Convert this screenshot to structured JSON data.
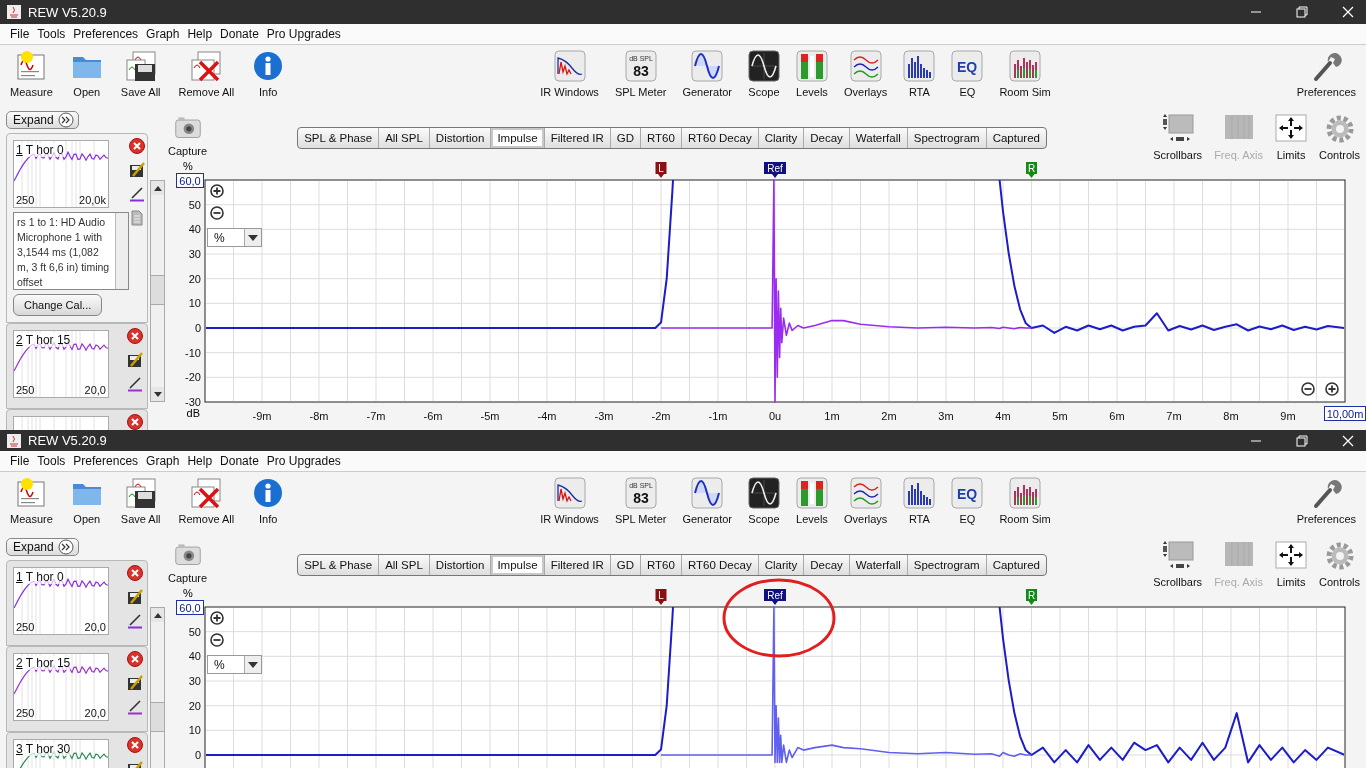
{
  "windows": [
    {
      "title": "REW V5.20.9",
      "menu": [
        "File",
        "Tools",
        "Preferences",
        "Graph",
        "Help",
        "Donate",
        "Pro Upgrades"
      ],
      "toolbar_left": [
        {
          "kind": "measure",
          "label": "Measure"
        },
        {
          "kind": "open",
          "label": "Open"
        },
        {
          "kind": "save",
          "label": "Save All"
        },
        {
          "kind": "remove",
          "label": "Remove All"
        },
        {
          "kind": "info",
          "label": "Info"
        }
      ],
      "toolbar_tools": [
        {
          "kind": "ir",
          "label": "IR Windows"
        },
        {
          "kind": "spl",
          "label": "SPL Meter",
          "icon_unit": "dB SPL",
          "icon_text": "83"
        },
        {
          "kind": "generator",
          "label": "Generator"
        },
        {
          "kind": "scope",
          "label": "Scope"
        },
        {
          "kind": "levels",
          "label": "Levels"
        },
        {
          "kind": "overlays",
          "label": "Overlays"
        },
        {
          "kind": "rta",
          "label": "RTA"
        },
        {
          "kind": "eq",
          "label": "EQ",
          "icon_text": "EQ"
        },
        {
          "kind": "roomsim",
          "label": "Room Sim"
        }
      ],
      "toolbar_right": [
        {
          "kind": "preferences",
          "label": "Preferences"
        }
      ],
      "expand_button": "Expand",
      "measurements": [
        {
          "number": "1",
          "name": "T hor 0",
          "color": "#8a2be2",
          "expanded": true,
          "axis_min": "250",
          "axis_max": "20,0k",
          "notes": "rs 1 to 1: HD Audio Microphone 1 with 3,1544 ms (1,082 m, 3 ft 6,6 in) timing offset",
          "button": "Change Cal..."
        },
        {
          "number": "2",
          "name": "T hor 15",
          "color": "#9b30d0",
          "expanded": false,
          "axis_min": "250",
          "axis_max": "20,0"
        },
        {
          "expanded": false
        }
      ],
      "capture": "Capture",
      "tabs": [
        {
          "label": "SPL & Phase",
          "selected": false
        },
        {
          "label": "All SPL",
          "selected": false
        },
        {
          "label": "Distortion",
          "selected": false
        },
        {
          "label": "Impulse",
          "selected": true
        },
        {
          "label": "Filtered IR",
          "selected": false
        },
        {
          "label": "GD",
          "selected": false
        },
        {
          "label": "RT60",
          "selected": false
        },
        {
          "label": "RT60 Decay",
          "selected": false
        },
        {
          "label": "Clarity",
          "selected": false
        },
        {
          "label": "Decay",
          "selected": false
        },
        {
          "label": "Waterfall",
          "selected": false
        },
        {
          "label": "Spectrogram",
          "selected": false
        },
        {
          "label": "Captured",
          "selected": false
        }
      ],
      "view_buttons": [
        {
          "kind": "scrollbars",
          "label": "Scrollbars",
          "disabled": false
        },
        {
          "kind": "freqaxis",
          "label": "Freq. Axis",
          "disabled": true
        },
        {
          "kind": "limits",
          "label": "Limits",
          "disabled": false
        },
        {
          "kind": "controls",
          "label": "Controls",
          "disabled": false
        }
      ],
      "chart": {
        "y_unit": "%",
        "y_bottom_unit": "dB",
        "unit_selector": "%",
        "markers": [
          {
            "kind": "left",
            "label": "L"
          },
          {
            "kind": "ref",
            "label": "Ref"
          },
          {
            "kind": "right",
            "label": "R"
          }
        ],
        "highlighted": false,
        "chart_data": {
          "type": "line",
          "grid": true,
          "xlim": [
            -10,
            10
          ],
          "ylim": [
            -30,
            60
          ],
          "x": [
            -10,
            -8,
            -6,
            -4,
            -2.1,
            -2,
            -1.9,
            -1.8,
            -1.79,
            -1,
            -0.05,
            -0.02,
            0,
            0.02,
            0.04,
            0.06,
            0.08,
            0.1,
            0.12,
            0.15,
            0.2,
            0.25,
            0.3,
            0.4,
            0.5,
            0.7,
            1,
            1.2,
            1.5,
            2,
            2.5,
            3,
            3.5,
            3.8,
            3.94,
            4,
            4.1,
            4.2,
            4.3,
            4.4,
            4.5,
            4.7,
            4.9,
            5.1,
            5.3,
            5.5,
            5.7,
            5.9,
            6.1,
            6.3,
            6.5,
            6.7,
            6.9,
            7.1,
            7.3,
            7.5,
            7.7,
            7.9,
            8.1,
            8.3,
            8.5,
            8.7,
            8.9,
            9.1,
            9.3,
            9.5,
            9.7,
            10
          ],
          "series": [
            {
              "color": "#1c1cc8",
              "values": [
                0,
                0,
                0,
                0,
                0,
                2.2,
                20,
                55.6,
                60,
                null,
                null,
                null,
                null,
                null,
                null,
                null,
                null,
                null,
                null,
                null,
                null,
                null,
                null,
                null,
                null,
                null,
                null,
                null,
                null,
                null,
                null,
                null,
                null,
                null,
                60,
                47.3,
                30.3,
                17,
                7.6,
                1.9,
                0,
                1,
                -2,
                0.5,
                -1,
                1,
                -0.5,
                1,
                -1,
                0.5,
                1,
                6,
                -1,
                0.8,
                -0.6,
                1,
                -0.8,
                0.5,
                1.5,
                -1,
                0.6,
                -0.5,
                1,
                -0.8,
                0.5,
                -0.6,
                0.8,
                0
              ]
            },
            {
              "color": "#9a2cf0",
              "values": [
                null,
                null,
                null,
                null,
                null,
                0,
                0,
                0,
                0,
                0,
                0,
                60,
                -30,
                20,
                -20,
                15,
                -12,
                8,
                -6,
                4,
                -3,
                2,
                -1,
                1,
                0,
                1,
                3,
                3,
                1.5,
                0.5,
                0,
                0.3,
                0,
                0.2,
                -0.2,
                0.3,
                0,
                -0.3,
                0.2,
                0,
                0,
                null,
                null,
                null,
                null,
                null,
                null,
                null,
                null,
                null,
                null,
                null,
                null,
                null,
                null,
                null,
                null,
                null,
                null,
                null,
                null,
                null,
                null,
                null,
                null,
                null,
                null,
                null
              ]
            }
          ],
          "xticks": [
            {
              "value": -9,
              "label": "-9m"
            },
            {
              "value": -8,
              "label": "-8m"
            },
            {
              "value": -7,
              "label": "-7m"
            },
            {
              "value": -6,
              "label": "-6m"
            },
            {
              "value": -5,
              "label": "-5m"
            },
            {
              "value": -4,
              "label": "-4m"
            },
            {
              "value": -3,
              "label": "-3m"
            },
            {
              "value": -2,
              "label": "-2m"
            },
            {
              "value": -1,
              "label": "-1m"
            },
            {
              "value": 0,
              "label": "0u"
            },
            {
              "value": 1,
              "label": "1m"
            },
            {
              "value": 2,
              "label": "2m"
            },
            {
              "value": 3,
              "label": "3m"
            },
            {
              "value": 4,
              "label": "4m"
            },
            {
              "value": 5,
              "label": "5m"
            },
            {
              "value": 6,
              "label": "6m"
            },
            {
              "value": 7,
              "label": "7m"
            },
            {
              "value": 8,
              "label": "8m"
            },
            {
              "value": 9,
              "label": "9m"
            },
            {
              "value": 10,
              "label": "10,00m"
            }
          ],
          "yticks": [
            {
              "value": 60,
              "label": "60,0"
            },
            50,
            40,
            30,
            20,
            10,
            0,
            -10,
            -20,
            -30
          ]
        }
      }
    },
    {
      "title": "REW V5.20.9",
      "menu": [
        "File",
        "Tools",
        "Preferences",
        "Graph",
        "Help",
        "Donate",
        "Pro Upgrades"
      ],
      "toolbar_left": [
        {
          "kind": "measure",
          "label": "Measure"
        },
        {
          "kind": "open",
          "label": "Open"
        },
        {
          "kind": "save",
          "label": "Save All"
        },
        {
          "kind": "remove",
          "label": "Remove All"
        },
        {
          "kind": "info",
          "label": "Info"
        }
      ],
      "toolbar_tools": [
        {
          "kind": "ir",
          "label": "IR Windows"
        },
        {
          "kind": "spl",
          "label": "SPL Meter",
          "icon_unit": "dB SPL",
          "icon_text": "83"
        },
        {
          "kind": "generator",
          "label": "Generator"
        },
        {
          "kind": "scope",
          "label": "Scope"
        },
        {
          "kind": "levels",
          "label": "Levels"
        },
        {
          "kind": "overlays",
          "label": "Overlays"
        },
        {
          "kind": "rta",
          "label": "RTA"
        },
        {
          "kind": "eq",
          "label": "EQ",
          "icon_text": "EQ"
        },
        {
          "kind": "roomsim",
          "label": "Room Sim"
        }
      ],
      "toolbar_right": [
        {
          "kind": "preferences",
          "label": "Preferences"
        }
      ],
      "expand_button": "Expand",
      "measurements": [
        {
          "number": "1",
          "name": "T hor 0",
          "color": "#8a2be2",
          "expanded": false,
          "axis_min": "250",
          "axis_max": "20,0"
        },
        {
          "number": "2",
          "name": "T hor 15",
          "color": "#9b30d0",
          "expanded": false,
          "axis_min": "250",
          "axis_max": "20,0"
        },
        {
          "number": "3",
          "name": "T hor 30",
          "color": "#2e8b57",
          "expanded": false
        }
      ],
      "capture": "Capture",
      "tabs": [
        {
          "label": "SPL & Phase",
          "selected": false
        },
        {
          "label": "All SPL",
          "selected": false
        },
        {
          "label": "Distortion",
          "selected": false
        },
        {
          "label": "Impulse",
          "selected": true
        },
        {
          "label": "Filtered IR",
          "selected": false
        },
        {
          "label": "GD",
          "selected": false
        },
        {
          "label": "RT60",
          "selected": false
        },
        {
          "label": "RT60 Decay",
          "selected": false
        },
        {
          "label": "Clarity",
          "selected": false
        },
        {
          "label": "Decay",
          "selected": false
        },
        {
          "label": "Waterfall",
          "selected": false
        },
        {
          "label": "Spectrogram",
          "selected": false
        },
        {
          "label": "Captured",
          "selected": false
        }
      ],
      "view_buttons": [
        {
          "kind": "scrollbars",
          "label": "Scrollbars",
          "disabled": false
        },
        {
          "kind": "freqaxis",
          "label": "Freq. Axis",
          "disabled": true
        },
        {
          "kind": "limits",
          "label": "Limits",
          "disabled": false
        },
        {
          "kind": "controls",
          "label": "Controls",
          "disabled": false
        }
      ],
      "chart": {
        "y_unit": "%",
        "unit_selector": "%",
        "markers": [
          {
            "kind": "left",
            "label": "L"
          },
          {
            "kind": "ref",
            "label": "Ref"
          },
          {
            "kind": "right",
            "label": "R"
          }
        ],
        "highlighted": true,
        "chart_data": {
          "type": "line",
          "grid": true,
          "xlim": [
            -10,
            10
          ],
          "ylim": [
            -30,
            60
          ],
          "x": [
            -10,
            -8,
            -6,
            -4,
            -2.1,
            -2,
            -1.9,
            -1.8,
            -1.79,
            -1,
            -0.05,
            -0.02,
            0,
            0.02,
            0.04,
            0.06,
            0.08,
            0.1,
            0.12,
            0.15,
            0.2,
            0.25,
            0.3,
            0.4,
            0.5,
            0.7,
            1,
            1.2,
            1.5,
            2,
            2.5,
            3,
            3.5,
            3.8,
            3.94,
            4,
            4.1,
            4.2,
            4.3,
            4.4,
            4.5,
            4.7,
            4.9,
            5.1,
            5.3,
            5.5,
            5.7,
            5.9,
            6.1,
            6.3,
            6.5,
            6.7,
            6.9,
            7.1,
            7.3,
            7.5,
            7.7,
            7.9,
            8.1,
            8.3,
            8.5,
            8.7,
            8.9,
            9.1,
            9.3,
            9.5,
            9.7,
            10
          ],
          "series": [
            {
              "color": "#1c1cc8",
              "values": [
                0,
                0,
                0,
                0,
                0,
                2.2,
                20,
                55.6,
                60,
                null,
                null,
                null,
                null,
                null,
                null,
                null,
                null,
                null,
                null,
                null,
                null,
                null,
                null,
                null,
                null,
                null,
                null,
                null,
                null,
                null,
                null,
                null,
                null,
                null,
                60,
                47.3,
                30.3,
                17,
                7.6,
                1.9,
                0,
                3,
                -3,
                2,
                -3,
                4,
                -2,
                3,
                -2,
                5,
                2,
                4,
                -3,
                3,
                -2,
                5,
                -2,
                3,
                17,
                -3,
                4,
                -2,
                3,
                -3,
                2,
                -2,
                3,
                0
              ]
            },
            {
              "color": "#6060f0",
              "values": [
                null,
                null,
                null,
                null,
                null,
                0,
                0,
                0,
                0,
                0,
                0,
                60,
                -3,
                20,
                -3,
                15,
                -3,
                8,
                -3,
                4,
                -3,
                2,
                -1,
                3,
                2,
                3,
                4,
                3,
                2.5,
                1,
                0.5,
                1,
                0.3,
                0.5,
                -0.5,
                1,
                0,
                -0.5,
                0.5,
                0,
                0,
                null,
                null,
                null,
                null,
                null,
                null,
                null,
                null,
                null,
                null,
                null,
                null,
                null,
                null,
                null,
                null,
                null,
                null,
                null,
                null,
                null,
                null,
                null,
                null,
                null,
                null,
                null
              ]
            }
          ],
          "yticks": [
            {
              "value": 60,
              "label": "60,0"
            },
            50,
            40,
            30,
            20,
            10,
            0
          ]
        }
      }
    }
  ]
}
